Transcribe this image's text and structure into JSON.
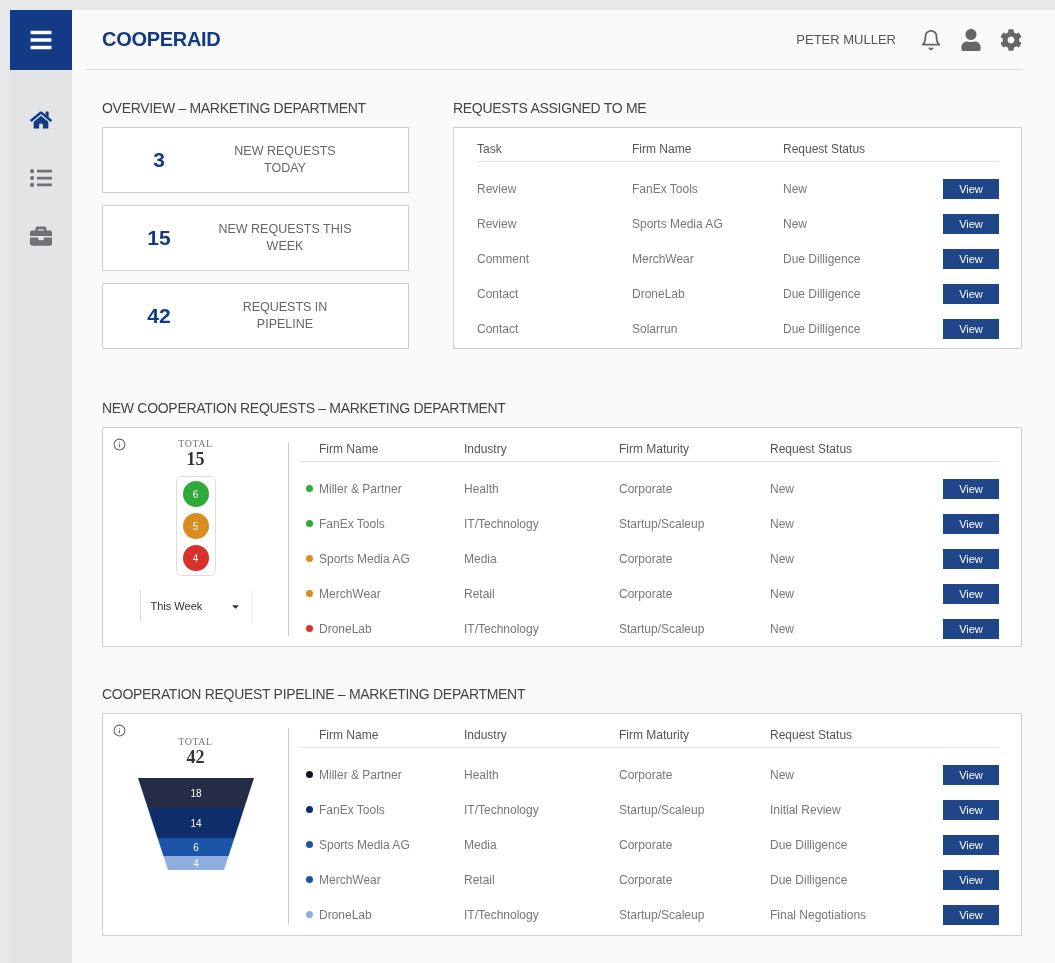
{
  "app": {
    "title": "COOPERAID",
    "user": "PETER MULLER"
  },
  "sidebar": {
    "items": [
      {
        "kind": "home",
        "selected": true
      },
      {
        "kind": "list",
        "selected": false
      },
      {
        "kind": "briefcase",
        "selected": false
      }
    ]
  },
  "overview": {
    "title": "OVERVIEW – MARKETING DEPARTMENT",
    "stats": [
      {
        "value": "3",
        "label": "NEW REQUESTS TODAY"
      },
      {
        "value": "15",
        "label": "NEW REQUESTS THIS WEEK"
      },
      {
        "value": "42",
        "label": "REQUESTS IN PIPELINE"
      }
    ]
  },
  "assigned": {
    "title": "REQUESTS ASSIGNED TO ME",
    "columns": [
      "Task",
      "Firm Name",
      "Request Status"
    ],
    "rows": [
      {
        "cells": [
          "Review",
          "FanEx Tools",
          "New"
        ],
        "action": "View"
      },
      {
        "cells": [
          "Review",
          "Sports Media AG",
          "New"
        ],
        "action": "View"
      },
      {
        "cells": [
          "Comment",
          "MerchWear",
          "Due Dilligence"
        ],
        "action": "View"
      },
      {
        "cells": [
          "Contact",
          "DroneLab",
          "Due Dilligence"
        ],
        "action": "View"
      },
      {
        "cells": [
          "Contact",
          "Solarrun",
          "Due Dilligence"
        ],
        "action": "View"
      }
    ]
  },
  "new_requests": {
    "title": "NEW COOPERATION REQUESTS – MARKETING DEPARTMENT",
    "total_label": "TOTAL",
    "total": "15",
    "lights": [
      {
        "value": "6",
        "color": "#2eaa3a"
      },
      {
        "value": "5",
        "color": "#d98c1f"
      },
      {
        "value": "4",
        "color": "#d8302a"
      }
    ],
    "period": "This Week",
    "columns": [
      "Firm Name",
      "Industry",
      "Firm Maturity",
      "Request Status"
    ],
    "rows": [
      {
        "color": "#2eaa3a",
        "cells": [
          "Miller & Partner",
          "Health",
          "Corporate",
          "New"
        ],
        "action": "View"
      },
      {
        "color": "#2eaa3a",
        "cells": [
          "FanEx Tools",
          "IT/Technology",
          "Startup/Scaleup",
          "New"
        ],
        "action": "View"
      },
      {
        "color": "#d98c1f",
        "cells": [
          "Sports Media AG",
          "Media",
          "Corporate",
          "New"
        ],
        "action": "View"
      },
      {
        "color": "#d98c1f",
        "cells": [
          "MerchWear",
          "Retail",
          "Corporate",
          "New"
        ],
        "action": "View"
      },
      {
        "color": "#d8302a",
        "cells": [
          "DroneLab",
          "IT/Technology",
          "Startup/Scaleup",
          "New"
        ],
        "action": "View"
      }
    ]
  },
  "pipeline": {
    "title": "COOPERATION REQUEST PIPELINE – MARKETING DEPARTMENT",
    "total_label": "TOTAL",
    "total": "42",
    "stages": [
      {
        "value": "18",
        "color": "#252c45"
      },
      {
        "value": "14",
        "color": "#0f2d6b"
      },
      {
        "value": "6",
        "color": "#1c54a8"
      },
      {
        "value": "4",
        "color": "#8eaee0"
      }
    ],
    "columns": [
      "Firm Name",
      "Industry",
      "Firm Maturity",
      "Request Status"
    ],
    "rows": [
      {
        "color": "#111827",
        "cells": [
          "Miller & Partner",
          "Health",
          "Corporate",
          "New"
        ],
        "action": "View"
      },
      {
        "color": "#0f2d6b",
        "cells": [
          "FanEx Tools",
          "IT/Technology",
          "Startup/Scaleup",
          "Initial Review"
        ],
        "action": "View"
      },
      {
        "color": "#1c54a8",
        "cells": [
          "Sports Media AG",
          "Media",
          "Corporate",
          "Due Dilligence"
        ],
        "action": "View"
      },
      {
        "color": "#1c54a8",
        "cells": [
          "MerchWear",
          "Retail",
          "Corporate",
          "Due Dilligence"
        ],
        "action": "View"
      },
      {
        "color": "#8eaee0",
        "cells": [
          "DroneLab",
          "IT/Technology",
          "Startup/Scaleup",
          "Final Negotiations"
        ],
        "action": "View"
      }
    ]
  }
}
